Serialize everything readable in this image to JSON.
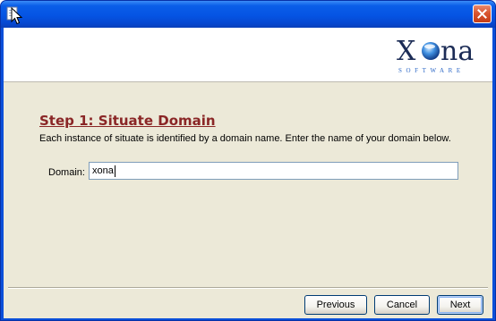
{
  "window": {
    "title": "",
    "titlebar_color": "#0554e3"
  },
  "banner": {
    "logo": {
      "name": "Xona",
      "tagline": "SOFTWARE"
    }
  },
  "step": {
    "title": "Step 1: Situate Domain",
    "description": "Each instance of situate is identified by a domain name. Enter the name of your domain below.",
    "title_color": "#8a2626"
  },
  "form": {
    "domain_label": "Domain:",
    "domain_value": "xona"
  },
  "buttons": {
    "previous": "Previous",
    "cancel": "Cancel",
    "next": "Next"
  },
  "icons": [
    "app-icon",
    "close-icon",
    "xona-logo",
    "mouse-cursor"
  ]
}
